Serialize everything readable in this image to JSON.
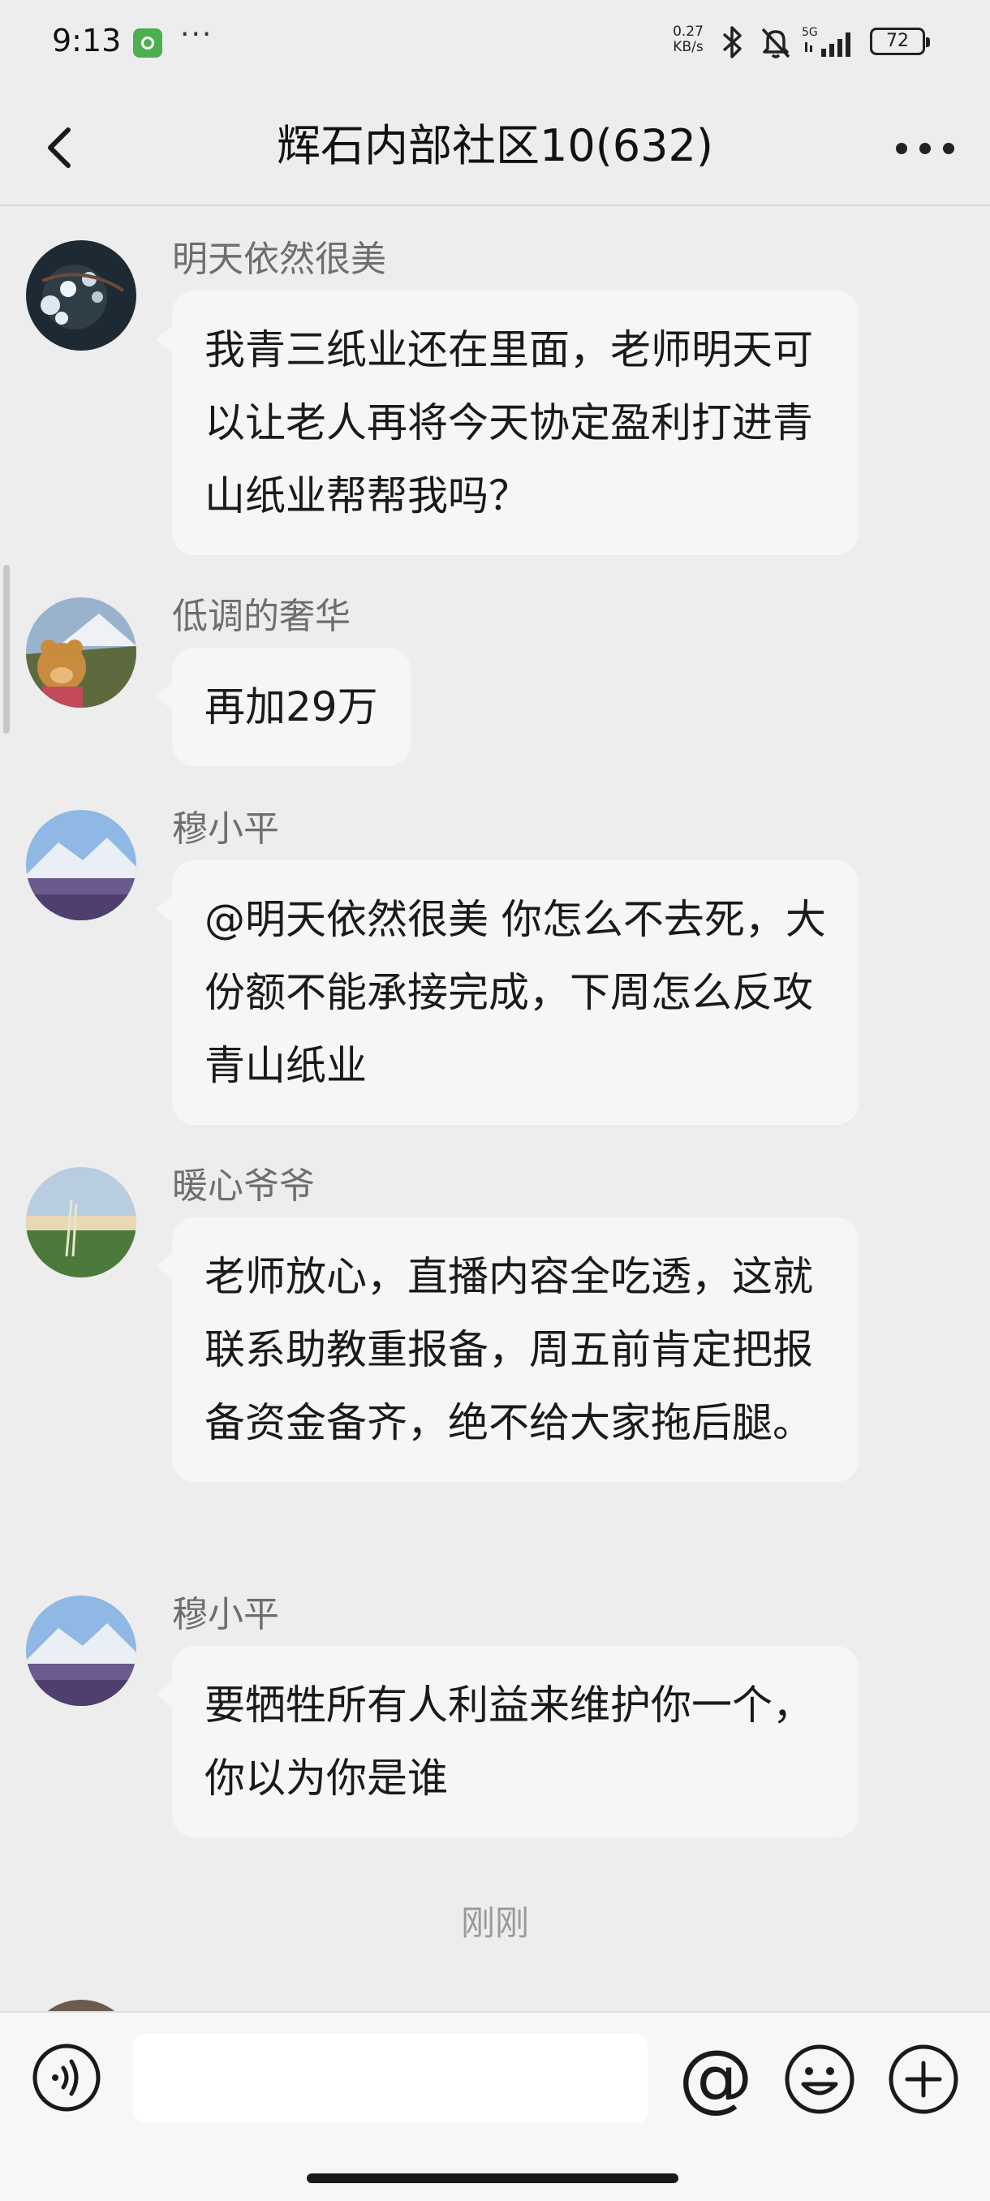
{
  "status_bar": {
    "time": "9:13",
    "more": "···",
    "speed_value": "0.27",
    "speed_unit": "KB/s",
    "network": "5G",
    "battery": "72"
  },
  "header": {
    "title": "辉石内部社区10(632)"
  },
  "messages": [
    {
      "sender": "明天依然很美",
      "text": "我青三纸业还在里面，老师明天可以让老人再将今天协定盈利打进青山纸业帮帮我吗？"
    },
    {
      "sender": "低调的奢华",
      "text": "再加29万"
    },
    {
      "sender": "穆小平",
      "text": "@明天依然很美  你怎么不去死，大份额不能承接完成，下周怎么反攻青山纸业"
    },
    {
      "sender": "暖心爷爷",
      "text": "老师放心，直播内容全吃透，这就联系助教重报备，周五前肯定把报备资金备齐，绝不给大家拖后腿。"
    },
    {
      "sender": "穆小平",
      "text": "要牺牲所有人利益来维护你一个，你以为你是谁"
    }
  ],
  "time_divider": "刚刚",
  "input_bar": {
    "placeholder": "",
    "mention_symbol": "@"
  },
  "colors": {
    "background": "#ededed",
    "bubble": "#f6f6f6",
    "sender_name": "#6e6e6e",
    "divider_text": "#9a9a9a"
  },
  "icons": {
    "back": "chevron-left-icon",
    "more": "more-dots-icon",
    "voice": "voice-icon",
    "emoji": "emoji-icon",
    "plus": "plus-icon"
  }
}
